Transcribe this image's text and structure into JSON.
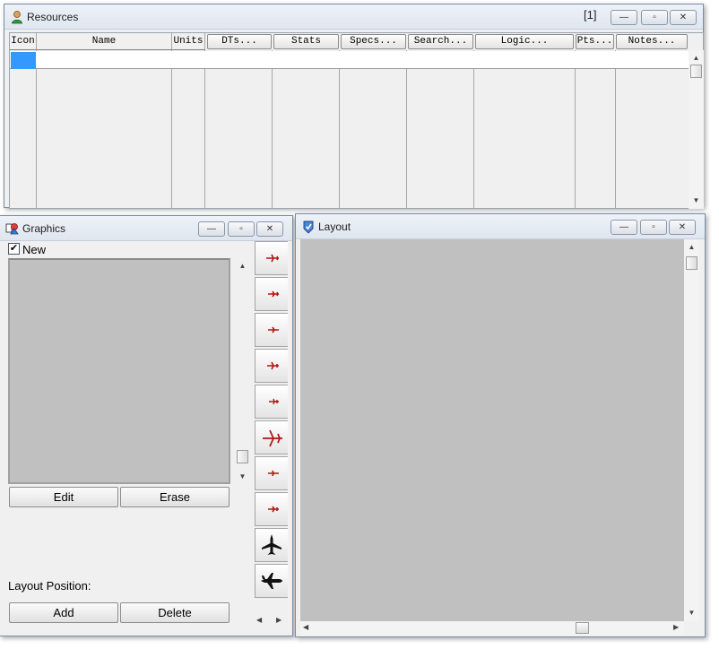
{
  "resources": {
    "title": "Resources",
    "counter": "[1]",
    "columns": [
      {
        "label": "Icon",
        "button": false
      },
      {
        "label": "Name",
        "button": false
      },
      {
        "label": "Units",
        "button": false
      },
      {
        "label": "DTs...",
        "button": true
      },
      {
        "label": "Stats",
        "button": true
      },
      {
        "label": "Specs...",
        "button": true
      },
      {
        "label": "Search...",
        "button": true
      },
      {
        "label": "Logic...",
        "button": true
      },
      {
        "label": "Pts...",
        "button": true
      },
      {
        "label": "Notes...",
        "button": true
      }
    ]
  },
  "graphics": {
    "title": "Graphics",
    "new_label": "New",
    "new_checked": true,
    "edit_label": "Edit",
    "erase_label": "Erase",
    "layout_position_label": "Layout Position:",
    "add_label": "Add",
    "delete_label": "Delete",
    "library_icons": [
      "small-jet-icon",
      "small-jet-icon",
      "small-jet-icon",
      "small-jet-icon",
      "small-jet-icon",
      "large-jet-icon",
      "small-jet-icon",
      "small-jet-icon",
      "airliner-top-icon",
      "airliner-side-icon"
    ]
  },
  "layout": {
    "title": "Layout"
  },
  "window_buttons": {
    "minimize": "—",
    "restore": "▫",
    "close": "✕"
  },
  "colors": {
    "selection": "#3399ff",
    "canvas": "#c0c0c0",
    "jet": "#b01515"
  }
}
